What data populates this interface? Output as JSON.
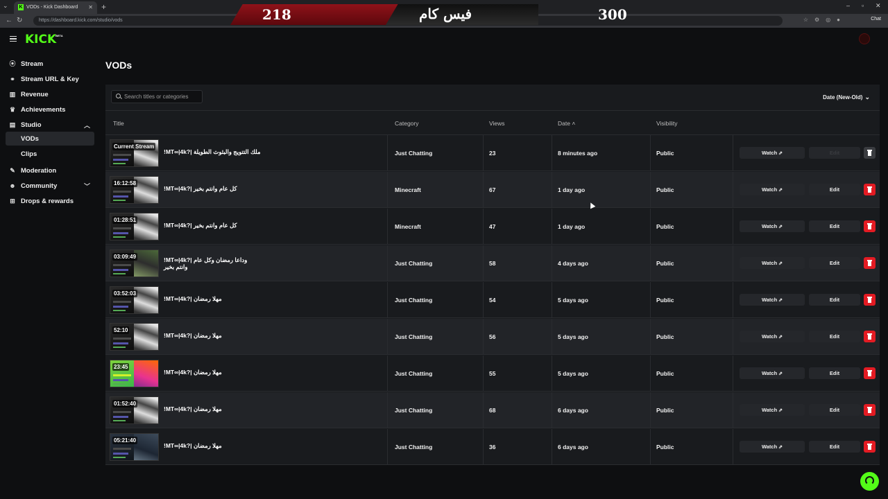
{
  "browser": {
    "tab_title": "VODs - Kick Dashboard",
    "url": "https://dashboard.kick.com/studio/vods",
    "chat_label": "Chat"
  },
  "overlay": {
    "left_value": "218",
    "center_text": "فيس كام",
    "right_value": "300"
  },
  "brand": {
    "logo": "KICK",
    "badge": "BETA",
    "accent": "#53fc18"
  },
  "sidebar": {
    "items": [
      {
        "label": "Stream",
        "icon": "broadcast-icon"
      },
      {
        "label": "Stream URL & Key",
        "icon": "link-icon"
      },
      {
        "label": "Revenue",
        "icon": "bar-chart-icon"
      },
      {
        "label": "Achievements",
        "icon": "trophy-icon"
      },
      {
        "label": "Studio",
        "icon": "film-icon"
      },
      {
        "label": "VODs"
      },
      {
        "label": "Clips"
      },
      {
        "label": "Moderation",
        "icon": "wrench-icon"
      },
      {
        "label": "Community",
        "icon": "people-icon"
      },
      {
        "label": "Drops & rewards",
        "icon": "gift-icon"
      }
    ]
  },
  "page": {
    "title": "VODs",
    "search_placeholder": "Search titles or categories",
    "sort_label": "Date (New-Old)"
  },
  "table": {
    "columns": [
      "Title",
      "Category",
      "Views",
      "Date",
      "Visibility"
    ],
    "watch_label": "Watch",
    "edit_label": "Edit",
    "rows": [
      {
        "duration": "Current Stream",
        "title": "!MT∞|4k?| ملك التتويج والبثوث الطويلة",
        "category": "Just Chatting",
        "views": "23",
        "date": "8 minutes ago",
        "visibility": "Public"
      },
      {
        "duration": "16:12:58",
        "title": "!MT∞|4k?| كل عام وانتم بخير",
        "category": "Minecraft",
        "views": "67",
        "date": "1 day ago",
        "visibility": "Public"
      },
      {
        "duration": "01:28:51",
        "title": "!MT∞|4k?| كل عام وانتم بخير",
        "category": "Minecraft",
        "views": "47",
        "date": "1 day ago",
        "visibility": "Public"
      },
      {
        "duration": "03:09:49",
        "title": "!MT∞|4k?| وداعا رمضان وكل عام وانتم بخير",
        "category": "Just Chatting",
        "views": "58",
        "date": "4 days ago",
        "visibility": "Public"
      },
      {
        "duration": "03:52:03",
        "title": "!MT∞|4k?| مهلا رمضان",
        "category": "Just Chatting",
        "views": "54",
        "date": "5 days ago",
        "visibility": "Public"
      },
      {
        "duration": "52:10",
        "title": "!MT∞|4k?| مهلا رمضان",
        "category": "Just Chatting",
        "views": "56",
        "date": "5 days ago",
        "visibility": "Public"
      },
      {
        "duration": "23:45",
        "title": "!MT∞|4k?| مهلا رمضان",
        "category": "Just Chatting",
        "views": "55",
        "date": "5 days ago",
        "visibility": "Public"
      },
      {
        "duration": "01:52:40",
        "title": "!MT∞|4k?| مهلا رمضان",
        "category": "Just Chatting",
        "views": "68",
        "date": "6 days ago",
        "visibility": "Public"
      },
      {
        "duration": "05:21:40",
        "title": "!MT∞|4k?| مهلا رمضان",
        "category": "Just Chatting",
        "views": "36",
        "date": "6 days ago",
        "visibility": "Public"
      }
    ]
  }
}
